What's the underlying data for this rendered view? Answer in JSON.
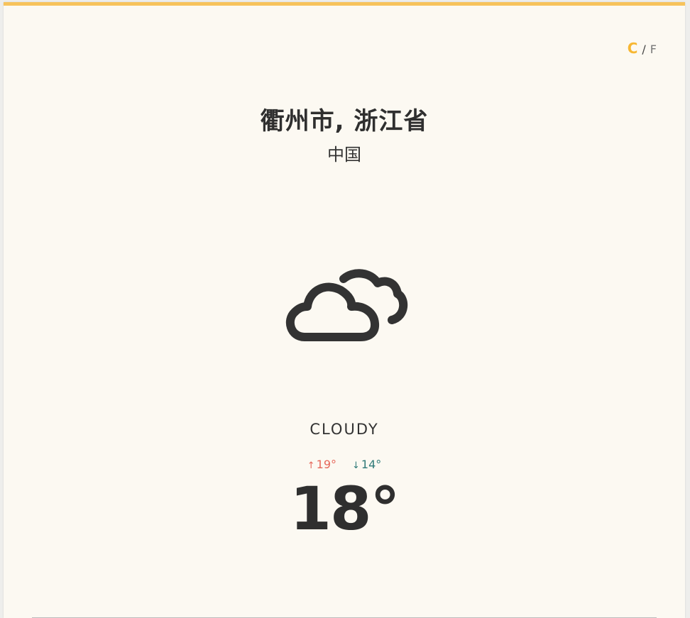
{
  "units": {
    "celsius_label": "C",
    "separator": "/",
    "fahrenheit_label": "F",
    "active": "C",
    "active_color": "#f7b733"
  },
  "location": {
    "city": "衢州市, 浙江省",
    "country": "中国"
  },
  "weather": {
    "icon": "cloudy-icon",
    "condition": "CLOUDY",
    "high_arrow": "↑",
    "high": "19°",
    "low_arrow": "↓",
    "low": "14°",
    "current_temp": "18°"
  },
  "colors": {
    "accent_top_border": "#f7c35c",
    "background": "#fcf9f2",
    "text": "#2f2f2f",
    "high": "#e6675a",
    "low": "#2f7a78"
  }
}
